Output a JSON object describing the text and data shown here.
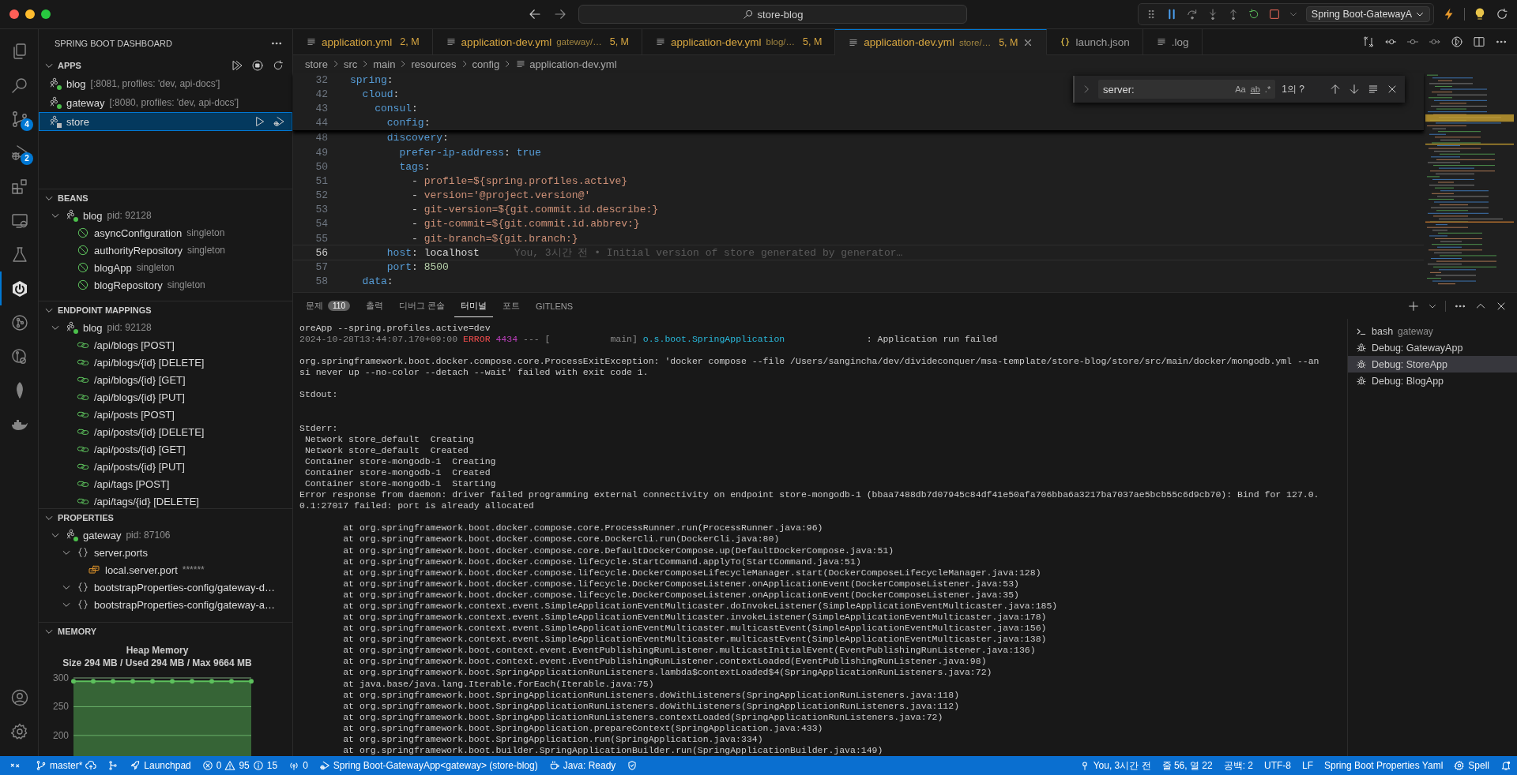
{
  "title_bar": {
    "search": "store-blog",
    "debug_config": "Spring Boot-GatewayA"
  },
  "activity_bar": [
    {
      "kind": "files",
      "selected": false
    },
    {
      "kind": "search",
      "selected": false
    },
    {
      "kind": "branch",
      "selected": false,
      "badge": "4"
    },
    {
      "kind": "debug",
      "selected": false,
      "badge": "2"
    },
    {
      "kind": "blocks",
      "selected": false
    },
    {
      "kind": "monitor",
      "selected": false
    },
    {
      "kind": "flask",
      "selected": false
    },
    {
      "kind": "power",
      "selected": true
    },
    {
      "kind": "graph",
      "selected": false
    },
    {
      "kind": "lens",
      "selected": false
    },
    {
      "kind": "leaf",
      "selected": false
    },
    {
      "kind": "whale",
      "selected": false
    }
  ],
  "activity_bottom": [
    {
      "kind": "person"
    },
    {
      "kind": "gear"
    }
  ],
  "sidebar": {
    "title": "SPRING BOOT DASHBOARD",
    "apps": {
      "title": "APPS",
      "expanded": true,
      "items": [
        {
          "name": "blog",
          "detail": "[:8081, profiles: 'dev, api-docs']",
          "running": true,
          "selected": false
        },
        {
          "name": "gateway",
          "detail": "[:8080, profiles: 'dev, api-docs']",
          "running": true,
          "selected": false
        },
        {
          "name": "store",
          "running": false,
          "selected": true
        }
      ]
    },
    "beans": {
      "title": "BEANS",
      "expanded": true,
      "tree": [
        {
          "kind": "app",
          "name": "blog",
          "detail": "pid: 92128",
          "running": true,
          "expanded": true,
          "children": [
            {
              "kind": "bean",
              "name": "asyncConfiguration",
              "detail": "singleton"
            },
            {
              "kind": "bean",
              "name": "authorityRepository",
              "detail": "singleton"
            },
            {
              "kind": "bean",
              "name": "blogApp",
              "detail": "singleton"
            },
            {
              "kind": "bean",
              "name": "blogRepository",
              "detail": "singleton"
            }
          ]
        }
      ]
    },
    "endpoint_mappings": {
      "title": "ENDPOINT MAPPINGS",
      "expanded": true,
      "tree": [
        {
          "kind": "app",
          "name": "blog",
          "detail": "pid: 92128",
          "running": true,
          "expanded": true,
          "children": [
            {
              "kind": "endpoint",
              "name": "/api/blogs [POST]"
            },
            {
              "kind": "endpoint",
              "name": "/api/blogs/{id} [DELETE]"
            },
            {
              "kind": "endpoint",
              "name": "/api/blogs/{id} [GET]"
            },
            {
              "kind": "endpoint",
              "name": "/api/blogs/{id} [PUT]"
            },
            {
              "kind": "endpoint",
              "name": "/api/posts [POST]"
            },
            {
              "kind": "endpoint",
              "name": "/api/posts/{id} [DELETE]"
            },
            {
              "kind": "endpoint",
              "name": "/api/posts/{id} [GET]"
            },
            {
              "kind": "endpoint",
              "name": "/api/posts/{id} [PUT]"
            },
            {
              "kind": "endpoint",
              "name": "/api/tags [POST]"
            },
            {
              "kind": "endpoint",
              "name": "/api/tags/{id} [DELETE]"
            }
          ]
        }
      ]
    },
    "properties": {
      "title": "PROPERTIES",
      "expanded": true,
      "tree": [
        {
          "kind": "app",
          "name": "gateway",
          "detail": "pid: 87106",
          "running": true,
          "expanded": true,
          "children": [
            {
              "kind": "group",
              "name": "server.ports",
              "expanded": true,
              "children": [
                {
                  "kind": "property",
                  "name": "local.server.port",
                  "detail": "******"
                }
              ]
            },
            {
              "kind": "group",
              "name": "bootstrapProperties-config/gateway-d…",
              "expanded": true
            },
            {
              "kind": "group",
              "name": "bootstrapProperties-config/gateway-a…",
              "expanded": true
            }
          ]
        }
      ]
    },
    "memory": {
      "title": "MEMORY",
      "expanded": true,
      "subtitle": "Size 294 MB / Used 294 MB / Max 9664 MB",
      "chart_data": {
        "type": "area",
        "title": "Heap Memory",
        "ylim": [
          160,
          300
        ],
        "grid": true,
        "yticks": [
          200,
          250,
          300
        ],
        "series": [
          {
            "color": "#5cc05c",
            "values": [
              294,
              294,
              294,
              294,
              294,
              294,
              294,
              294,
              294,
              294
            ]
          }
        ]
      }
    }
  },
  "editor": {
    "tabs": [
      {
        "kind": "yaml",
        "label": "application.yml",
        "badge": "2, M",
        "modified": true,
        "selected": false
      },
      {
        "kind": "yaml",
        "label": "application-dev.yml",
        "detail": "gateway/…",
        "badge": "5, M",
        "modified": true,
        "selected": false
      },
      {
        "kind": "yaml",
        "label": "application-dev.yml",
        "detail": "blog/…",
        "badge": "5, M",
        "modified": true,
        "selected": false
      },
      {
        "kind": "yaml",
        "label": "application-dev.yml",
        "detail": "store/…",
        "badge": "5, M",
        "modified": true,
        "selected": true
      },
      {
        "kind": "json",
        "label": "launch.json",
        "modified": false,
        "selected": false
      },
      {
        "kind": "log",
        "label": ".log",
        "modified": false,
        "selected": false
      }
    ],
    "breadcrumb": [
      "store",
      "src",
      "main",
      "resources",
      "config",
      "application-dev.yml"
    ],
    "sticky_lines": [
      {
        "number": "32",
        "tokens": [
          {
            "kind": "key",
            "text": "spring"
          },
          {
            "kind": "punct",
            "text": ":"
          }
        ]
      },
      {
        "number": "42",
        "tokens": [
          {
            "kind": "key",
            "text": "  cloud"
          },
          {
            "kind": "punct",
            "text": ":"
          }
        ]
      },
      {
        "number": "43",
        "tokens": [
          {
            "kind": "key",
            "text": "    consul"
          },
          {
            "kind": "punct",
            "text": ":"
          }
        ]
      },
      {
        "number": "44",
        "tokens": [
          {
            "kind": "key",
            "text": "      config"
          },
          {
            "kind": "punct",
            "text": ":"
          }
        ]
      }
    ],
    "lines": [
      {
        "number": "48",
        "tokens": [
          {
            "kind": "key",
            "text": "      discovery"
          },
          {
            "kind": "punct",
            "text": ":"
          }
        ]
      },
      {
        "number": "49",
        "tokens": [
          {
            "kind": "key",
            "text": "        prefer-ip-address"
          },
          {
            "kind": "punct",
            "text": ":"
          },
          {
            "kind": "bool",
            "text": " true"
          }
        ]
      },
      {
        "number": "50",
        "tokens": [
          {
            "kind": "key",
            "text": "        tags"
          },
          {
            "kind": "punct",
            "text": ":"
          }
        ]
      },
      {
        "number": "51",
        "tokens": [
          {
            "kind": "punct",
            "text": "          -"
          },
          {
            "kind": "str",
            "text": " profile=${spring.profiles.active}"
          }
        ]
      },
      {
        "number": "52",
        "tokens": [
          {
            "kind": "punct",
            "text": "          -"
          },
          {
            "kind": "str",
            "text": " version='@project.version@'"
          }
        ]
      },
      {
        "number": "53",
        "tokens": [
          {
            "kind": "punct",
            "text": "          -"
          },
          {
            "kind": "str",
            "text": " git-version=${git.commit.id.describe:}"
          }
        ]
      },
      {
        "number": "54",
        "tokens": [
          {
            "kind": "punct",
            "text": "          -"
          },
          {
            "kind": "str",
            "text": " git-commit=${git.commit.id.abbrev:}"
          }
        ]
      },
      {
        "number": "55",
        "tokens": [
          {
            "kind": "punct",
            "text": "          -"
          },
          {
            "kind": "str",
            "text": " git-branch=${git.branch:}"
          }
        ]
      },
      {
        "number": "56",
        "current": true,
        "tokens": [
          {
            "kind": "key",
            "text": "      host"
          },
          {
            "kind": "punct",
            "text": ":"
          },
          {
            "kind": "plain",
            "text": " localhost"
          }
        ],
        "blame": "You, 3시간 전 • Initial version of store generated by generator…"
      },
      {
        "number": "57",
        "current": false,
        "tokens": [
          {
            "kind": "key",
            "text": "      port"
          },
          {
            "kind": "punct",
            "text": ":"
          },
          {
            "kind": "num",
            "text": " 8500"
          }
        ]
      },
      {
        "number": "58",
        "tokens": [
          {
            "kind": "key",
            "text": "  data"
          },
          {
            "kind": "punct",
            "text": ":"
          }
        ]
      }
    ],
    "find": {
      "value": "server:",
      "options": [
        "Aa",
        "ab",
        ".*"
      ],
      "result": "1의 ?"
    }
  },
  "panel": {
    "tabs": [
      {
        "label": "문제",
        "badge": "110",
        "selected": false
      },
      {
        "label": "출력",
        "selected": false
      },
      {
        "label": "디버그 콘솔",
        "selected": false
      },
      {
        "label": "터미널",
        "selected": true
      },
      {
        "label": "포트",
        "selected": false
      },
      {
        "label": "GITLENS",
        "selected": false
      }
    ],
    "terminal": [
      {
        "kind": "text",
        "segments": [
          {
            "kind": "plain",
            "text": "oreApp --spring.profiles.active=dev"
          }
        ]
      },
      {
        "kind": "text",
        "segments": [
          {
            "kind": "date",
            "text": "2024-10-28T13:44:07.170+09:00"
          },
          {
            "kind": "error",
            "text": " ERROR"
          },
          {
            "kind": "pid",
            "text": " 4434"
          },
          {
            "kind": "date",
            "text": " --- [           main]"
          },
          {
            "kind": "logger",
            "text": " o.s.boot.SpringApplication"
          },
          {
            "kind": "plain",
            "text": "               : Application run failed"
          }
        ]
      },
      {
        "kind": "blank"
      },
      {
        "kind": "text",
        "segments": [
          {
            "kind": "plain",
            "text": "org.springframework.boot.docker.compose.core.ProcessExitException: 'docker compose --file /Users/sangincha/dev/divideconquer/msa-template/store-blog/store/src/main/docker/mongodb.yml --an"
          }
        ]
      },
      {
        "kind": "text",
        "segments": [
          {
            "kind": "plain",
            "text": "si never up --no-color --detach --wait' failed with exit code 1."
          }
        ]
      },
      {
        "kind": "blank"
      },
      {
        "kind": "text",
        "segments": [
          {
            "kind": "plain",
            "text": "Stdout:"
          }
        ]
      },
      {
        "kind": "blank"
      },
      {
        "kind": "blank"
      },
      {
        "kind": "text",
        "segments": [
          {
            "kind": "plain",
            "text": "Stderr:"
          }
        ]
      },
      {
        "kind": "text",
        "segments": [
          {
            "kind": "plain",
            "text": " Network store_default  Creating"
          }
        ]
      },
      {
        "kind": "text",
        "segments": [
          {
            "kind": "plain",
            "text": " Network store_default  Created"
          }
        ]
      },
      {
        "kind": "text",
        "segments": [
          {
            "kind": "plain",
            "text": " Container store-mongodb-1  Creating"
          }
        ]
      },
      {
        "kind": "text",
        "segments": [
          {
            "kind": "plain",
            "text": " Container store-mongodb-1  Created"
          }
        ]
      },
      {
        "kind": "text",
        "segments": [
          {
            "kind": "plain",
            "text": " Container store-mongodb-1  Starting"
          }
        ]
      },
      {
        "kind": "text",
        "segments": [
          {
            "kind": "plain",
            "text": "Error response from daemon: driver failed programming external connectivity on endpoint store-mongodb-1 (bbaa7488db7d07945c84df41e50afa706bba6a3217ba7037ae5bcb55c6d9cb70): Bind for 127.0."
          }
        ]
      },
      {
        "kind": "text",
        "segments": [
          {
            "kind": "plain",
            "text": "0.1:27017 failed: port is already allocated"
          }
        ]
      },
      {
        "kind": "blank"
      },
      {
        "kind": "text",
        "segments": [
          {
            "kind": "plain",
            "text": "        at org.springframework.boot.docker.compose.core.ProcessRunner.run(ProcessRunner.java:96)"
          }
        ]
      },
      {
        "kind": "text",
        "segments": [
          {
            "kind": "plain",
            "text": "        at org.springframework.boot.docker.compose.core.DockerCli.run(DockerCli.java:80)"
          }
        ]
      },
      {
        "kind": "text",
        "segments": [
          {
            "kind": "plain",
            "text": "        at org.springframework.boot.docker.compose.core.DefaultDockerCompose.up(DefaultDockerCompose.java:51)"
          }
        ]
      },
      {
        "kind": "text",
        "segments": [
          {
            "kind": "plain",
            "text": "        at org.springframework.boot.docker.compose.lifecycle.StartCommand.applyTo(StartCommand.java:51)"
          }
        ]
      },
      {
        "kind": "text",
        "segments": [
          {
            "kind": "plain",
            "text": "        at org.springframework.boot.docker.compose.lifecycle.DockerComposeLifecycleManager.start(DockerComposeLifecycleManager.java:128)"
          }
        ]
      },
      {
        "kind": "text",
        "segments": [
          {
            "kind": "plain",
            "text": "        at org.springframework.boot.docker.compose.lifecycle.DockerComposeListener.onApplicationEvent(DockerComposeListener.java:53)"
          }
        ]
      },
      {
        "kind": "text",
        "segments": [
          {
            "kind": "plain",
            "text": "        at org.springframework.boot.docker.compose.lifecycle.DockerComposeListener.onApplicationEvent(DockerComposeListener.java:35)"
          }
        ]
      },
      {
        "kind": "text",
        "segments": [
          {
            "kind": "plain",
            "text": "        at org.springframework.context.event.SimpleApplicationEventMulticaster.doInvokeListener(SimpleApplicationEventMulticaster.java:185)"
          }
        ]
      },
      {
        "kind": "text",
        "segments": [
          {
            "kind": "plain",
            "text": "        at org.springframework.context.event.SimpleApplicationEventMulticaster.invokeListener(SimpleApplicationEventMulticaster.java:178)"
          }
        ]
      },
      {
        "kind": "text",
        "segments": [
          {
            "kind": "plain",
            "text": "        at org.springframework.context.event.SimpleApplicationEventMulticaster.multicastEvent(SimpleApplicationEventMulticaster.java:156)"
          }
        ]
      },
      {
        "kind": "text",
        "segments": [
          {
            "kind": "plain",
            "text": "        at org.springframework.context.event.SimpleApplicationEventMulticaster.multicastEvent(SimpleApplicationEventMulticaster.java:138)"
          }
        ]
      },
      {
        "kind": "text",
        "segments": [
          {
            "kind": "plain",
            "text": "        at org.springframework.boot.context.event.EventPublishingRunListener.multicastInitialEvent(EventPublishingRunListener.java:136)"
          }
        ]
      },
      {
        "kind": "text",
        "segments": [
          {
            "kind": "plain",
            "text": "        at org.springframework.boot.context.event.EventPublishingRunListener.contextLoaded(EventPublishingRunListener.java:98)"
          }
        ]
      },
      {
        "kind": "text",
        "segments": [
          {
            "kind": "plain",
            "text": "        at org.springframework.boot.SpringApplicationRunListeners.lambda$contextLoaded$4(SpringApplicationRunListeners.java:72)"
          }
        ]
      },
      {
        "kind": "text",
        "segments": [
          {
            "kind": "plain",
            "text": "        at java.base/java.lang.Iterable.forEach(Iterable.java:75)"
          }
        ]
      },
      {
        "kind": "text",
        "segments": [
          {
            "kind": "plain",
            "text": "        at org.springframework.boot.SpringApplicationRunListeners.doWithListeners(SpringApplicationRunListeners.java:118)"
          }
        ]
      },
      {
        "kind": "text",
        "segments": [
          {
            "kind": "plain",
            "text": "        at org.springframework.boot.SpringApplicationRunListeners.doWithListeners(SpringApplicationRunListeners.java:112)"
          }
        ]
      },
      {
        "kind": "text",
        "segments": [
          {
            "kind": "plain",
            "text": "        at org.springframework.boot.SpringApplicationRunListeners.contextLoaded(SpringApplicationRunListeners.java:72)"
          }
        ]
      },
      {
        "kind": "text",
        "segments": [
          {
            "kind": "plain",
            "text": "        at org.springframework.boot.SpringApplication.prepareContext(SpringApplication.java:433)"
          }
        ]
      },
      {
        "kind": "text",
        "segments": [
          {
            "kind": "plain",
            "text": "        at org.springframework.boot.SpringApplication.run(SpringApplication.java:334)"
          }
        ]
      },
      {
        "kind": "text",
        "segments": [
          {
            "kind": "plain",
            "text": "        at org.springframework.boot.builder.SpringApplicationBuilder.run(SpringApplicationBuilder.java:149)"
          }
        ]
      }
    ],
    "terminals": [
      {
        "kind": "bash",
        "name": "bash",
        "detail": "gateway",
        "selected": false
      },
      {
        "kind": "debug",
        "name": "Debug: GatewayApp",
        "selected": false
      },
      {
        "kind": "debug",
        "name": "Debug: StoreApp",
        "selected": true
      },
      {
        "kind": "debug",
        "name": "Debug: BlogApp",
        "selected": false
      }
    ]
  },
  "status_bar": {
    "left": [
      {
        "kind": "remote"
      },
      {
        "kind": "branch",
        "text": "master*"
      },
      {
        "kind": "merge"
      },
      {
        "kind": "launchpad",
        "text": "Launchpad"
      },
      {
        "kind": "problems",
        "errors": "0",
        "warnings": "95",
        "infos": "15"
      },
      {
        "kind": "ports",
        "text": "0"
      },
      {
        "kind": "debug",
        "text": "Spring Boot-GatewayApp<gateway> (store-blog)"
      },
      {
        "kind": "java",
        "text": "Java: Ready"
      },
      {
        "kind": "shield"
      }
    ],
    "right": [
      {
        "kind": "blame",
        "text": "You, 3시간 전"
      },
      {
        "kind": "plain",
        "text": "줄 56, 열 22"
      },
      {
        "kind": "plain",
        "text": "공백: 2"
      },
      {
        "kind": "plain",
        "text": "UTF-8"
      },
      {
        "kind": "plain",
        "text": "LF"
      },
      {
        "kind": "plain",
        "text": "Spring Boot Properties Yaml"
      },
      {
        "kind": "spell",
        "text": "Spell"
      },
      {
        "kind": "bell"
      }
    ]
  }
}
